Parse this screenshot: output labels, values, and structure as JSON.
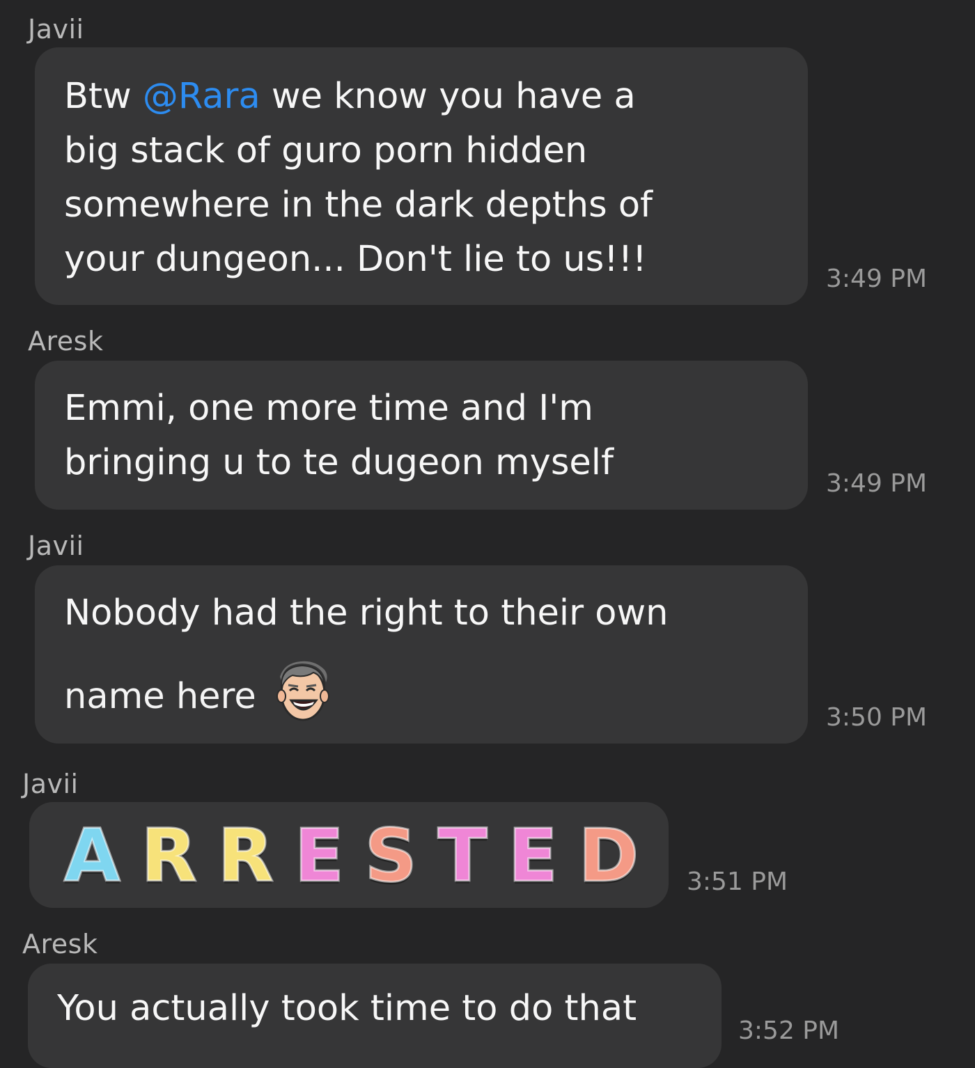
{
  "messages": [
    {
      "sender": "Javii",
      "text_before_mention": "Btw ",
      "mention": "@Rara",
      "text_after_mention": " we know you have a\nbig stack of guro porn hidden\nsomewhere in the dark depths of\nyour dungeon... Don't lie to us!!!",
      "time": "3:49 PM"
    },
    {
      "sender": "Aresk",
      "text": "Emmi, one more time and I'm\nbringing u to te dugeon myself",
      "time": "3:49 PM"
    },
    {
      "sender": "Javii",
      "text_line1": "Nobody had the right to their own",
      "text_line2": "name here",
      "emoji": "laughing-man-face-icon",
      "time": "3:50 PM"
    },
    {
      "sender": "Javii",
      "sticker_text": "ARRESTED",
      "sticker_letters": [
        "A",
        "R",
        "R",
        "E",
        "S",
        "T",
        "E",
        "D"
      ],
      "sticker_colors": [
        "#7fd6f0",
        "#f7e27a",
        "#f7e27a",
        "#ef86d6",
        "#f49a86",
        "#ef86d6",
        "#ef86d6",
        "#f49a86"
      ],
      "time": "3:51 PM"
    },
    {
      "sender": "Aresk",
      "text": "You actually took time to do that",
      "time": "3:52 PM"
    }
  ],
  "colors": {
    "background": "#252526",
    "bubble": "#363637",
    "mention": "#2d8cf0",
    "timestamp": "#9a9a9a",
    "sender": "#b9b9b9"
  }
}
